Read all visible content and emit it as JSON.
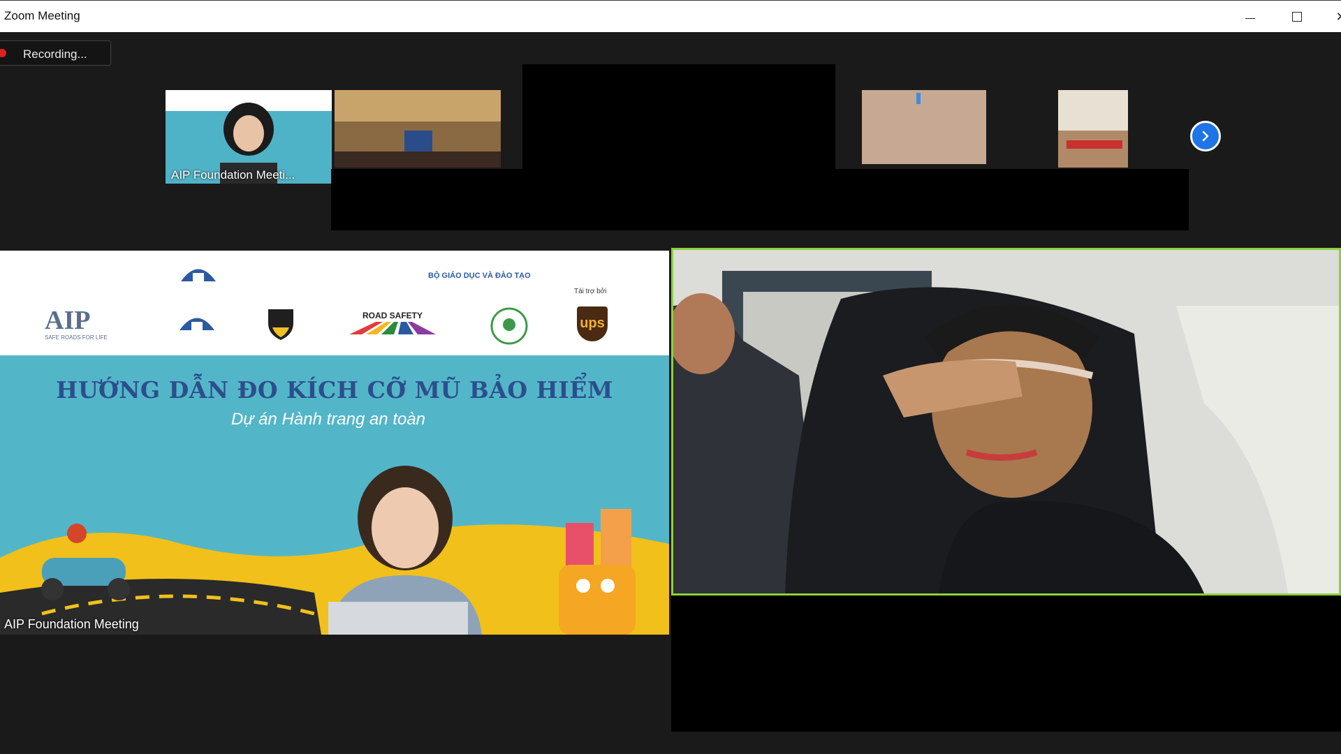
{
  "window": {
    "title": "Zoom Meeting",
    "minimize_label": "–",
    "maximize_label": "□",
    "close_label": "×"
  },
  "recording": {
    "status": "Recording..."
  },
  "gallery": {
    "thumbnails": [
      {
        "label": "AIP Foundation Meeti..."
      },
      {
        "label": ""
      },
      {
        "label": ""
      },
      {
        "label": ""
      }
    ],
    "next_page_icon": "chevron-right-icon"
  },
  "main": {
    "shared_slide": {
      "partner_text_1": "BỘ GIÁO DỤC VÀ ĐÀO TẠO",
      "partner_text_2": "Tài trợ bởi",
      "logo_aip": "AIP",
      "logo_aip_sub": "SAFE ROADS FOR LIFE",
      "logo_road_safety": "ROAD SAFETY",
      "logo_ups": "ups",
      "headline": "HƯỚNG DẪN ĐO KÍCH CỠ MŨ BẢO HIỂM",
      "subheadline": "Dự án Hành trang an toàn"
    },
    "left_label": "AIP Foundation Meeting",
    "active_speaker_color": "#8cd13a"
  }
}
